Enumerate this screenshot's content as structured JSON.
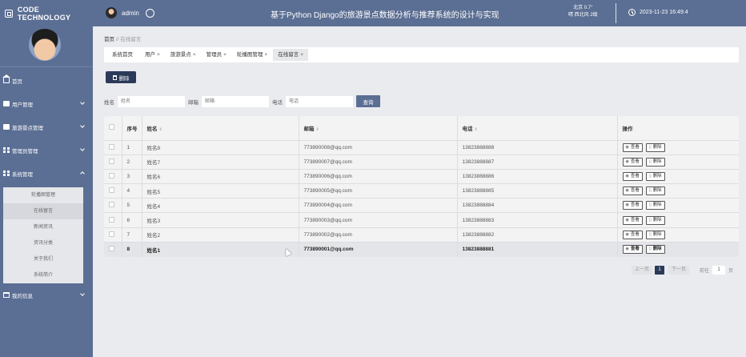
{
  "header": {
    "logo_text": "CODE TECHNOLOGY",
    "username": "admin",
    "system_title": "基于Python Django的旅游景点数据分析与推荐系统的设计与实现",
    "weather_line1": "北京  0.7°",
    "weather_line2": "晴  西北风  2级",
    "datetime": "2023-11-23 16:49:4"
  },
  "sidebar": {
    "items": [
      {
        "label": "首页"
      },
      {
        "label": "用户管理"
      },
      {
        "label": "旅游景点管理"
      },
      {
        "label": "管理员管理"
      },
      {
        "label": "系统管理"
      },
      {
        "label": "我的信息"
      }
    ],
    "submenu": [
      "轮播图管理",
      "在线留言",
      "新闻资讯",
      "资讯分类",
      "关于我们",
      "系统简介"
    ]
  },
  "breadcrumb": {
    "home": "首页",
    "sep": "//",
    "current": "在线留言"
  },
  "tabs": [
    {
      "label": "系统首页",
      "closable": ""
    },
    {
      "label": "用户",
      "closable": "×"
    },
    {
      "label": "旅游景点",
      "closable": "×"
    },
    {
      "label": "管理员",
      "closable": "×"
    },
    {
      "label": "轮播图管理",
      "closable": "×"
    },
    {
      "label": "在线留言",
      "closable": "×"
    }
  ],
  "toolbar": {
    "delete_label": "删除"
  },
  "search": {
    "name_label": "姓名",
    "name_placeholder": "姓名",
    "email_label": "邮箱",
    "email_placeholder": "邮箱",
    "phone_label": "电话",
    "phone_placeholder": "电话",
    "query_label": "查询"
  },
  "table": {
    "columns": [
      "序号",
      "姓名",
      "邮箱",
      "电话",
      "操作"
    ],
    "view_label": "查看",
    "delete_label": "删除",
    "rows": [
      {
        "no": "1",
        "name": "姓名8",
        "email": "773890008@qq.com",
        "phone": "13823888888"
      },
      {
        "no": "2",
        "name": "姓名7",
        "email": "773890007@qq.com",
        "phone": "13823888887"
      },
      {
        "no": "3",
        "name": "姓名6",
        "email": "773890006@qq.com",
        "phone": "13823888886"
      },
      {
        "no": "4",
        "name": "姓名5",
        "email": "773890005@qq.com",
        "phone": "13823888885"
      },
      {
        "no": "5",
        "name": "姓名4",
        "email": "773890004@qq.com",
        "phone": "13823888884"
      },
      {
        "no": "6",
        "name": "姓名3",
        "email": "773890003@qq.com",
        "phone": "13823888883"
      },
      {
        "no": "7",
        "name": "姓名2",
        "email": "773890002@qq.com",
        "phone": "13823888882"
      },
      {
        "no": "8",
        "name": "姓名1",
        "email": "773890001@qq.com",
        "phone": "13823888881"
      }
    ]
  },
  "pagination": {
    "prev": "上一页",
    "current": "1",
    "next": "下一页",
    "goto": "前往",
    "page_value": "1",
    "page_unit": "页"
  },
  "colors": {
    "primary": "#5b6e93",
    "dark": "#2b3a59",
    "background": "#e9ebef"
  }
}
